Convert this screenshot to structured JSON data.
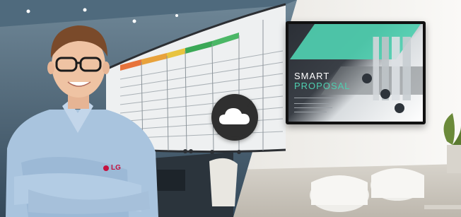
{
  "display": {
    "title_line1": "SMART",
    "title_line2": "PROPOSAL"
  },
  "badge": {
    "logo_text": "LG"
  },
  "colors": {
    "accent_teal": "#4fcfb0",
    "sync_disk": "#2f2f2f",
    "wall": "#f4f3f0"
  },
  "icons": {
    "sync": "cloud-sync-icon"
  }
}
